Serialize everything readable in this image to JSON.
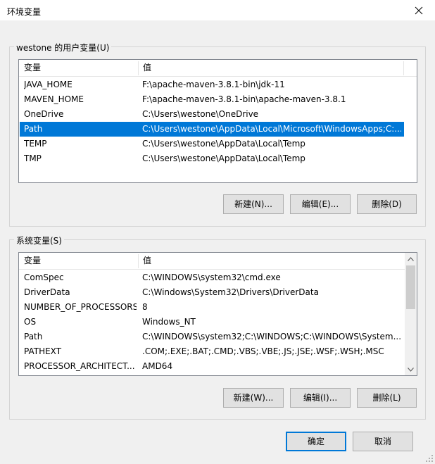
{
  "window": {
    "title": "环境变量"
  },
  "user_vars": {
    "legend": "westone 的用户变量(U)",
    "col_name": "变量",
    "col_value": "值",
    "rows": [
      {
        "name": "JAVA_HOME",
        "value": "F:\\apache-maven-3.8.1-bin\\jdk-11"
      },
      {
        "name": "MAVEN_HOME",
        "value": "F:\\apache-maven-3.8.1-bin\\apache-maven-3.8.1"
      },
      {
        "name": "OneDrive",
        "value": "C:\\Users\\westone\\OneDrive"
      },
      {
        "name": "Path",
        "value": "C:\\Users\\westone\\AppData\\Local\\Microsoft\\WindowsApps;C:..."
      },
      {
        "name": "TEMP",
        "value": "C:\\Users\\westone\\AppData\\Local\\Temp"
      },
      {
        "name": "TMP",
        "value": "C:\\Users\\westone\\AppData\\Local\\Temp"
      }
    ],
    "selected_index": 3,
    "new_label": "新建(N)...",
    "edit_label": "编辑(E)...",
    "delete_label": "删除(D)"
  },
  "system_vars": {
    "legend": "系统变量(S)",
    "col_name": "变量",
    "col_value": "值",
    "rows": [
      {
        "name": "ComSpec",
        "value": "C:\\WINDOWS\\system32\\cmd.exe"
      },
      {
        "name": "DriverData",
        "value": "C:\\Windows\\System32\\Drivers\\DriverData"
      },
      {
        "name": "NUMBER_OF_PROCESSORS",
        "value": "8"
      },
      {
        "name": "OS",
        "value": "Windows_NT"
      },
      {
        "name": "Path",
        "value": "C:\\WINDOWS\\system32;C:\\WINDOWS;C:\\WINDOWS\\System..."
      },
      {
        "name": "PATHEXT",
        "value": ".COM;.EXE;.BAT;.CMD;.VBS;.VBE;.JS;.JSE;.WSF;.WSH;.MSC"
      },
      {
        "name": "PROCESSOR_ARCHITECT...",
        "value": "AMD64"
      }
    ],
    "new_label": "新建(W)...",
    "edit_label": "编辑(I)...",
    "delete_label": "删除(L)"
  },
  "footer": {
    "ok_label": "确定",
    "cancel_label": "取消"
  },
  "colors": {
    "selection": "#0078d7",
    "accent": "#0078d7"
  }
}
